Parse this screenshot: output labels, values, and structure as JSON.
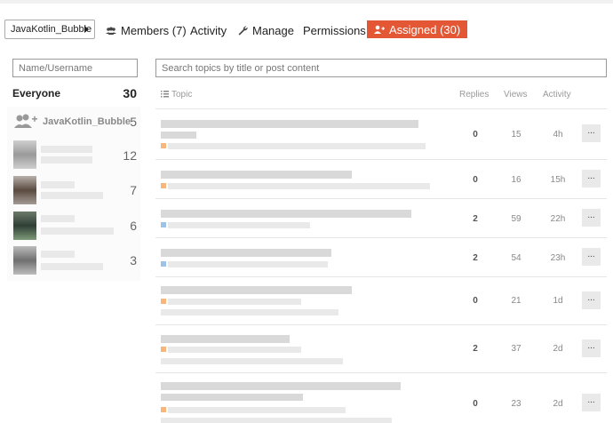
{
  "header": {
    "group_select": "JavaKotlin_Bubble",
    "nav": {
      "members": "Members (7)",
      "activity": "Activity",
      "manage": "Manage",
      "permissions": "Permissions",
      "assigned": "Assigned (30)"
    }
  },
  "filter": {
    "placeholder": "Name/Username"
  },
  "search": {
    "placeholder": "Search topics by title or post content"
  },
  "users": {
    "everyone": {
      "label": "Everyone",
      "count": "30"
    },
    "group": {
      "label": "JavaKotlin_Bubble",
      "count": "5"
    },
    "members": [
      {
        "count": "12"
      },
      {
        "count": "7"
      },
      {
        "count": "6"
      },
      {
        "count": "3"
      }
    ]
  },
  "table": {
    "headers": {
      "topic": "Topic",
      "replies": "Replies",
      "views": "Views",
      "activity": "Activity"
    },
    "rows": [
      {
        "replies": "0",
        "views": "15",
        "activity": "4h",
        "more": "..."
      },
      {
        "replies": "0",
        "views": "16",
        "activity": "15h",
        "more": "..."
      },
      {
        "replies": "2",
        "views": "59",
        "activity": "22h",
        "more": "..."
      },
      {
        "replies": "2",
        "views": "54",
        "activity": "23h",
        "more": "..."
      },
      {
        "replies": "0",
        "views": "21",
        "activity": "1d",
        "more": "..."
      },
      {
        "replies": "2",
        "views": "37",
        "activity": "2d",
        "more": "..."
      },
      {
        "replies": "0",
        "views": "23",
        "activity": "2d",
        "more": "..."
      }
    ]
  },
  "colors": {
    "accent": "#e45735",
    "category_orange": "#f7b77b",
    "category_blue": "#9cc2e8"
  }
}
